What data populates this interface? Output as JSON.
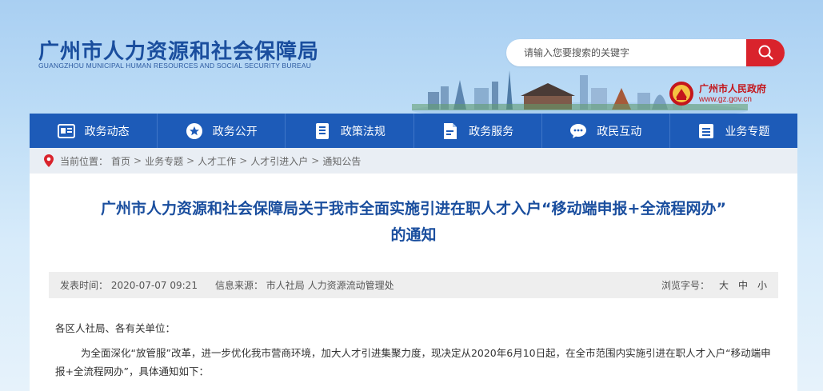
{
  "header": {
    "title": "广州市人力资源和社会保障局",
    "subtitle": "GUANGZHOU MUNICIPAL HUMAN RESOURCES AND SOCIAL SECURITY BUREAU",
    "search": {
      "placeholder": "请输入您要搜索的关键字"
    },
    "gov_badge": {
      "name": "广州市人民政府",
      "url": "www.gz.gov.cn"
    }
  },
  "nav": {
    "items": [
      {
        "label": "政务动态",
        "icon": "news-icon"
      },
      {
        "label": "政务公开",
        "icon": "star-icon"
      },
      {
        "label": "政策法规",
        "icon": "book-icon"
      },
      {
        "label": "政务服务",
        "icon": "document-icon"
      },
      {
        "label": "政民互动",
        "icon": "chat-icon"
      },
      {
        "label": "业务专题",
        "icon": "list-icon"
      }
    ]
  },
  "breadcrumb": {
    "label": "当前位置：",
    "items": [
      "首页",
      "业务专题",
      "人才工作",
      "人才引进入户",
      "通知公告"
    ]
  },
  "article": {
    "title_line1": "广州市人力资源和社会保障局关于我市全面实施引进在职人才入户“移动端申报+全流程网办”",
    "title_line2": "的通知",
    "meta": {
      "date": "发表时间：  2020-07-07 09:21",
      "source": "信息来源：  市人社局 人力资源流动管理处",
      "font_size_label": "浏览字号：",
      "font_sizes": [
        "大",
        "中",
        "小"
      ]
    },
    "paragraphs": [
      "各区人社局、各有关单位：",
      "为全面深化“放管服”改革，进一步优化我市营商环境，加大人才引进集聚力度，现决定从2020年6月10日起，在全市范围内实施引进在职人才入户“移动端申报+全流程网办”，具体通知如下："
    ]
  },
  "colors": {
    "brand_blue": "#1d5bb8",
    "title_blue": "#1a4e9e",
    "search_red": "#d9232c",
    "gov_red": "#c4161c"
  }
}
